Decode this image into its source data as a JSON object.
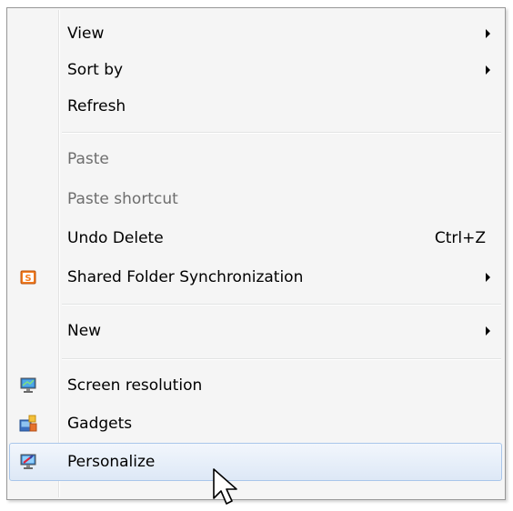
{
  "menu": {
    "items": [
      {
        "label": "View",
        "submenu": true
      },
      {
        "label": "Sort by",
        "submenu": true
      },
      {
        "label": "Refresh"
      },
      {
        "label": "Paste",
        "disabled": true
      },
      {
        "label": "Paste shortcut",
        "disabled": true
      },
      {
        "label": "Undo Delete",
        "shortcut": "Ctrl+Z"
      },
      {
        "label": "Shared Folder Synchronization",
        "submenu": true,
        "icon": "shared-folder-sync-icon",
        "icon_glyph": "S"
      },
      {
        "label": "New",
        "submenu": true
      },
      {
        "label": "Screen resolution",
        "icon": "screen-resolution-icon"
      },
      {
        "label": "Gadgets",
        "icon": "gadgets-icon"
      },
      {
        "label": "Personalize",
        "icon": "personalize-icon",
        "highlighted": true
      }
    ]
  },
  "colors": {
    "menu_background": "#f5f5f5",
    "menu_border": "#979797",
    "disabled_text": "#6d6d6d",
    "highlight_border": "#a9c6ea",
    "sync_icon_orange": "#f57c1f"
  },
  "cursor": {
    "icon": "mouse-pointer-icon"
  }
}
